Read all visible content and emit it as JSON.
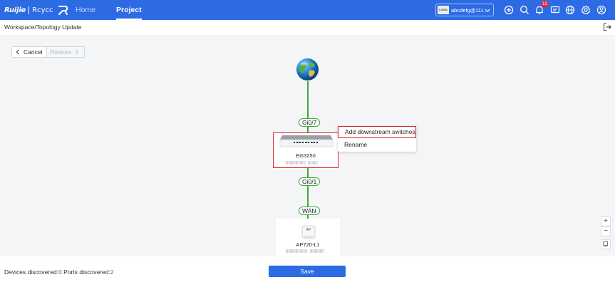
{
  "header": {
    "logo_brand": "Ruijie",
    "logo_sub": "Rcycc",
    "tabs": [
      {
        "label": "Home",
        "active": false
      },
      {
        "label": "Project",
        "active": true
      }
    ],
    "account": {
      "logo_text": "LOGO",
      "name": "abcdefg@111...."
    },
    "notification_count": "12",
    "icons": [
      "add-circle-icon",
      "search-icon",
      "bell-icon",
      "message-icon",
      "globe-icon",
      "settings-icon",
      "user-icon"
    ],
    "brand_color": "#2d6be4"
  },
  "breadcrumb": "Workspace/Topology Update",
  "toolbar": {
    "cancel_label": "Cancel",
    "restore_label": "Restore"
  },
  "topology": {
    "uplink_port": "Gi0/7",
    "gateway": {
      "name": "EG3250"
    },
    "downlink_port": "Gi0/1",
    "ap_port": "WAN",
    "ap": {
      "name": "AP720-L1",
      "icon_text": "AP"
    },
    "link_color": "#3fa83f"
  },
  "context_menu": {
    "items": [
      "Add downstream switches",
      "Rename"
    ]
  },
  "zoom": {
    "in_label": "+",
    "out_label": "−"
  },
  "footer": {
    "devices_label": "Devices discovered:",
    "devices_count": "0",
    "ports_label": " Ports discovered:",
    "ports_count": "2",
    "save_label": "Save"
  }
}
